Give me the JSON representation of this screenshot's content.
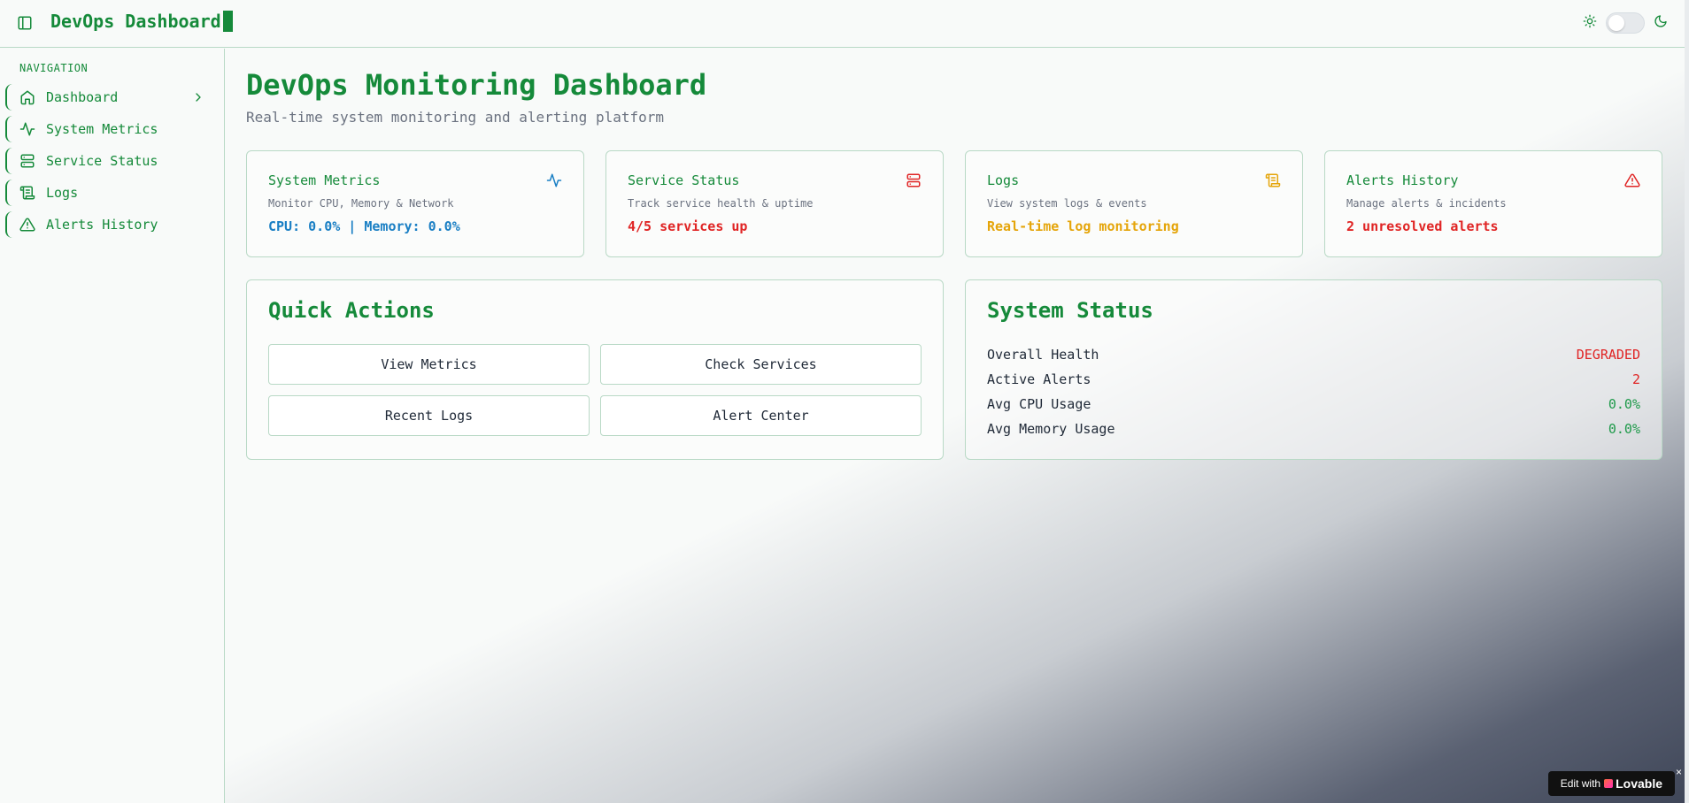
{
  "header": {
    "title": "DevOps Dashboard",
    "sidebar_toggle_icon": "sidebar-panel-icon",
    "theme_light_icon": "sun-icon",
    "theme_dark_icon": "moon-icon",
    "theme_toggle_on": false
  },
  "sidebar": {
    "heading": "NAVIGATION",
    "items": [
      {
        "label": "Dashboard",
        "icon": "home-icon",
        "has_chevron": true
      },
      {
        "label": "System Metrics",
        "icon": "activity-icon"
      },
      {
        "label": "Service Status",
        "icon": "server-icon"
      },
      {
        "label": "Logs",
        "icon": "scroll-icon"
      },
      {
        "label": "Alerts History",
        "icon": "alert-triangle-icon"
      }
    ]
  },
  "main": {
    "title": "DevOps Monitoring Dashboard",
    "subtitle": "Real-time system monitoring and alerting platform",
    "cards": [
      {
        "title": "System Metrics",
        "description": "Monitor CPU, Memory & Network",
        "value": "CPU: 0.0% | Memory: 0.0%",
        "value_color": "#1a7fc4",
        "icon": "activity-icon",
        "icon_color": "#1a7fc4"
      },
      {
        "title": "Service Status",
        "description": "Track service health & uptime",
        "value": "4/5 services up",
        "value_color": "#e02424",
        "icon": "server-icon",
        "icon_color": "#e02424"
      },
      {
        "title": "Logs",
        "description": "View system logs & events",
        "value": "Real-time log monitoring",
        "value_color": "#e5a50a",
        "icon": "scroll-icon",
        "icon_color": "#e5a50a"
      },
      {
        "title": "Alerts History",
        "description": "Manage alerts & incidents",
        "value": "2 unresolved alerts",
        "value_color": "#e02424",
        "icon": "alert-triangle-icon",
        "icon_color": "#e02424"
      }
    ],
    "quick_actions": {
      "title": "Quick Actions",
      "buttons": [
        "View Metrics",
        "Check Services",
        "Recent Logs",
        "Alert Center"
      ]
    },
    "system_status": {
      "title": "System Status",
      "rows": [
        {
          "label": "Overall Health",
          "value": "DEGRADED",
          "color": "#e02424"
        },
        {
          "label": "Active Alerts",
          "value": "2",
          "color": "#e02424"
        },
        {
          "label": "Avg CPU Usage",
          "value": "0.0%",
          "color": "#1e9a4a"
        },
        {
          "label": "Avg Memory Usage",
          "value": "0.0%",
          "color": "#1e9a4a"
        }
      ]
    }
  },
  "badge": {
    "prefix": "Edit with",
    "brand": "Lovable",
    "close": "×"
  },
  "colors": {
    "accent": "#158a3a",
    "border": "#b9d9c6"
  }
}
